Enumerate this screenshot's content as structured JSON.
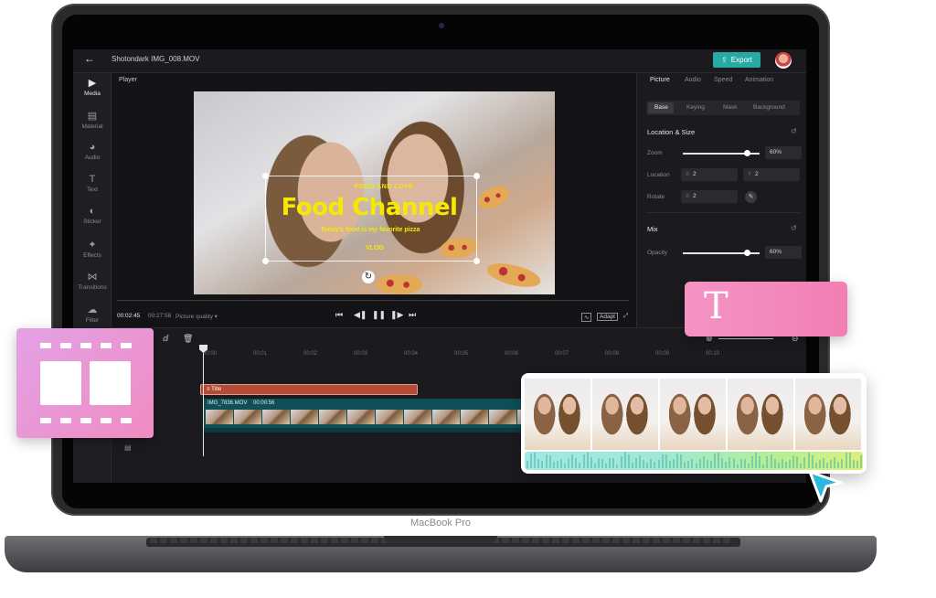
{
  "device": {
    "label": "MacBook Pro"
  },
  "topbar": {
    "back_icon": "arrow-left-icon",
    "file_name": "Shotondark IMG_008.MOV",
    "export_label": "Export"
  },
  "sidebar": {
    "items": [
      {
        "label": "Media",
        "icon": "media-icon",
        "active": true
      },
      {
        "label": "Material",
        "icon": "material-icon"
      },
      {
        "label": "Audio",
        "icon": "audio-icon"
      },
      {
        "label": "Text",
        "icon": "text-icon"
      },
      {
        "label": "Sticker",
        "icon": "sticker-icon"
      },
      {
        "label": "Effects",
        "icon": "effects-icon"
      },
      {
        "label": "Transitions",
        "icon": "transitions-icon"
      },
      {
        "label": "Filter",
        "icon": "filter-icon"
      }
    ]
  },
  "player": {
    "label": "Player",
    "overlay": {
      "small": "FOOD AND LOVE",
      "title": "Food Channel",
      "subtitle": "Today's food is my favorite pizza",
      "tag": "VLOG"
    },
    "current_time": "00:02:45",
    "total_time": "00:27:58",
    "quality_label": "Picture quality",
    "adapt_label": "Adapt"
  },
  "panel": {
    "tabs": [
      "Picture",
      "Audio",
      "Speed",
      "Animation"
    ],
    "active_tab": "Picture",
    "subtabs": [
      "Base",
      "Keying",
      "Mask",
      "Background"
    ],
    "section_location": "Location & Size",
    "zoom_label": "Zoom",
    "zoom_value": "60%",
    "zoom_level": 0.6,
    "location_label": "Location",
    "location_x_prefix": "X",
    "location_x": "2",
    "location_y_prefix": "Y",
    "location_y": "2",
    "rotate_label": "Rotate",
    "rotate_prefix": "X",
    "rotate_value": "2",
    "section_mix": "Mix",
    "opacity_label": "Opacity",
    "opacity_value": "60%",
    "opacity_level": 0.6
  },
  "timeline": {
    "ruler": [
      "00:00",
      "00:01",
      "00:02",
      "00:03",
      "00:04",
      "00:05",
      "00:06",
      "00:07",
      "00:08",
      "00:09",
      "00:10"
    ],
    "title_clip": "Title",
    "video_clip_name": "IMG_7836.MOV",
    "video_clip_duration": "00:00:56"
  },
  "colors": {
    "accent": "#27a9a4",
    "caption": "#f5e900",
    "title_clip": "#b34b36",
    "video_clip": "#0f4f55"
  }
}
